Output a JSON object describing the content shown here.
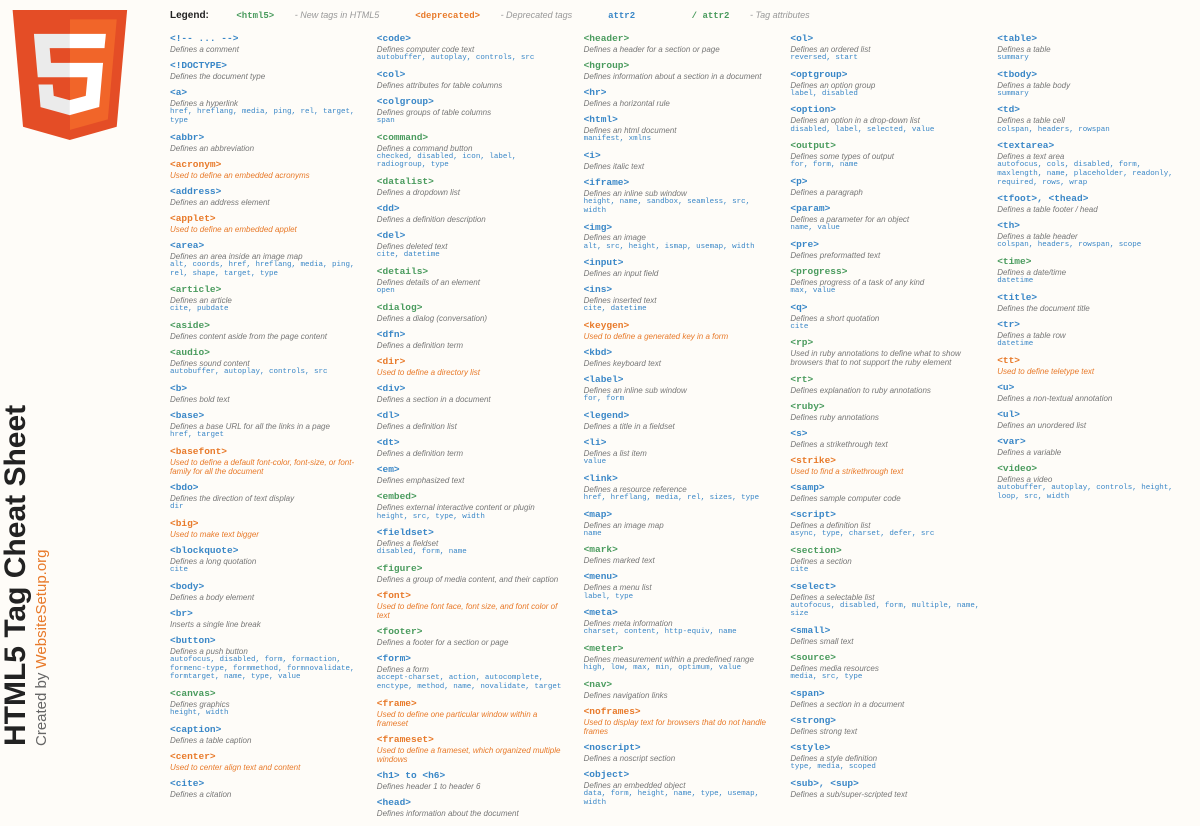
{
  "title": "HTML5 Tag Cheat Sheet",
  "subtitle_prefix": "Created by ",
  "subtitle_org": "WebsiteSetup.org",
  "legend_label": "Legend:",
  "legend_items": [
    {
      "tag": "<html5>",
      "cls": "green",
      "desc": "- New tags in HTML5"
    },
    {
      "tag": "<deprecated>",
      "cls": "warn",
      "desc": "- Deprecated tags"
    },
    {
      "tag": "attr2",
      "cls": "blue",
      "desc": ""
    },
    {
      "tag": "/  attr2",
      "cls": "green",
      "desc": "- Tag attributes"
    }
  ],
  "columns": [
    [
      {
        "tag": "<!-- ... -->",
        "cls": "normal",
        "desc": "Defines a comment"
      },
      {
        "tag": "<!DOCTYPE>",
        "cls": "normal",
        "desc": "Defines the document type"
      },
      {
        "tag": "<a>",
        "cls": "normal",
        "desc": "Defines a hyperlink",
        "attrs": "href, hreflang, media, ping, rel, target, type"
      },
      {
        "tag": "<abbr>",
        "cls": "normal",
        "desc": "Defines an abbreviation"
      },
      {
        "tag": "<acronym>",
        "cls": "dep",
        "desc": "Used to define an embedded acronyms",
        "depdesc": true
      },
      {
        "tag": "<address>",
        "cls": "normal",
        "desc": "Defines an address element"
      },
      {
        "tag": "<applet>",
        "cls": "dep",
        "desc": "Used to define an embedded applet",
        "depdesc": true
      },
      {
        "tag": "<area>",
        "cls": "normal",
        "desc": "Defines an area inside an image map",
        "attrs": "alt, coords, href, hreflang, media, ping, rel, shape, target, type"
      },
      {
        "tag": "<article>",
        "cls": "new",
        "desc": "Defines an article",
        "attrs": "cite, pubdate"
      },
      {
        "tag": "<aside>",
        "cls": "new",
        "desc": "Defines content aside from the page content"
      },
      {
        "tag": "<audio>",
        "cls": "new",
        "desc": "Defines sound content",
        "attrs": "autobuffer, autoplay, controls, src"
      },
      {
        "tag": "<b>",
        "cls": "normal",
        "desc": "Defines bold text"
      },
      {
        "tag": "<base>",
        "cls": "normal",
        "desc": "Defines a base URL for all the links in a page",
        "attrs": "href, target"
      },
      {
        "tag": "<basefont>",
        "cls": "dep",
        "desc": "Used to define a default font-color, font-size, or font-family for all the document",
        "depdesc": true
      },
      {
        "tag": "<bdo>",
        "cls": "normal",
        "desc": "Defines the direction of text display",
        "attrs": "dir"
      },
      {
        "tag": "<big>",
        "cls": "dep",
        "desc": "Used to make text bigger",
        "depdesc": true
      },
      {
        "tag": "<blockquote>",
        "cls": "normal",
        "desc": "Defines a long quotation",
        "attrs": "cite"
      },
      {
        "tag": "<body>",
        "cls": "normal",
        "desc": "Defines a body element"
      },
      {
        "tag": "<br>",
        "cls": "normal",
        "desc": "Inserts a single line break"
      },
      {
        "tag": "<button>",
        "cls": "normal",
        "desc": "Defines a push button",
        "attrs": "autofocus, disabled, form, formaction, formenc-type, formmethod, formnovalidate, formtarget, name, type, value"
      },
      {
        "tag": "<canvas>",
        "cls": "new",
        "desc": "Defines graphics",
        "attrs": "height, width"
      },
      {
        "tag": "<caption>",
        "cls": "normal",
        "desc": "Defines a table caption"
      },
      {
        "tag": "<center>",
        "cls": "dep",
        "desc": "Used to center align text and content",
        "depdesc": true
      },
      {
        "tag": "<cite>",
        "cls": "normal",
        "desc": "Defines a citation"
      }
    ],
    [
      {
        "tag": "<code>",
        "cls": "normal",
        "desc": "Defines computer code text",
        "attrs": "autobuffer, autoplay, controls, src"
      },
      {
        "tag": "<col>",
        "cls": "normal",
        "desc": "Defines attributes for table columns"
      },
      {
        "tag": "<colgroup>",
        "cls": "normal",
        "desc": "Defines groups of table columns",
        "attrs": "span"
      },
      {
        "tag": "<command>",
        "cls": "new",
        "desc": "Defines a command button",
        "attrs": "checked, disabled, icon, label, radiogroup, type"
      },
      {
        "tag": "<datalist>",
        "cls": "new",
        "desc": "Defines a dropdown list"
      },
      {
        "tag": "<dd>",
        "cls": "normal",
        "desc": "Defines a definition description"
      },
      {
        "tag": "<del>",
        "cls": "normal",
        "desc": "Defines deleted text",
        "attrs": "cite, datetime"
      },
      {
        "tag": "<details>",
        "cls": "new",
        "desc": "Defines details of an element",
        "attrs": "open"
      },
      {
        "tag": "<dialog>",
        "cls": "new",
        "desc": "Defines a dialog (conversation)"
      },
      {
        "tag": "<dfn>",
        "cls": "normal",
        "desc": "Defines a definition term"
      },
      {
        "tag": "<dir>",
        "cls": "dep",
        "desc": "Used to define a directory list",
        "depdesc": true
      },
      {
        "tag": "<div>",
        "cls": "normal",
        "desc": "Defines a section in a document"
      },
      {
        "tag": "<dl>",
        "cls": "normal",
        "desc": "Defines a definition list"
      },
      {
        "tag": "<dt>",
        "cls": "normal",
        "desc": "Defines a definition term"
      },
      {
        "tag": "<em>",
        "cls": "normal",
        "desc": "Defines emphasized text"
      },
      {
        "tag": "<embed>",
        "cls": "new",
        "desc": "Defines external interactive content or plugin",
        "attrs": "height, src, type, width"
      },
      {
        "tag": "<fieldset>",
        "cls": "normal",
        "desc": "Defines a fieldset",
        "attrs": "disabled, form, name"
      },
      {
        "tag": "<figure>",
        "cls": "new",
        "desc": "Defines a group of media content, and their caption"
      },
      {
        "tag": "<font>",
        "cls": "dep",
        "desc": "Used to define font face, font size, and font color of text",
        "depdesc": true
      },
      {
        "tag": "<footer>",
        "cls": "new",
        "desc": "Defines a footer for a section or page"
      },
      {
        "tag": "<form>",
        "cls": "normal",
        "desc": "Defines a form",
        "attrs": "accept-charset, action, autocomplete, enctype, method, name, novalidate, target"
      },
      {
        "tag": "<frame>",
        "cls": "dep",
        "desc": "Used to define one particular window within a frameset",
        "depdesc": true
      },
      {
        "tag": "<frameset>",
        "cls": "dep",
        "desc": "Used to define a frameset, which organized multiple windows",
        "depdesc": true
      },
      {
        "tag": "<h1> to <h6>",
        "cls": "normal",
        "desc": "Defines header 1 to header 6"
      },
      {
        "tag": "<head>",
        "cls": "normal",
        "desc": "Defines information about the document"
      }
    ],
    [
      {
        "tag": "<header>",
        "cls": "new",
        "desc": "Defines a header for a section or page"
      },
      {
        "tag": "<hgroup>",
        "cls": "new",
        "desc": "Defines information about a section in a document"
      },
      {
        "tag": "<hr>",
        "cls": "normal",
        "desc": "Defines a horizontal rule"
      },
      {
        "tag": "<html>",
        "cls": "normal",
        "desc": "Defines an html document",
        "attrs": "manifest, xmlns"
      },
      {
        "tag": "<i>",
        "cls": "normal",
        "desc": "Defines italic text"
      },
      {
        "tag": "<iframe>",
        "cls": "normal",
        "desc": "Defines an inline sub window",
        "attrs": "height, name, sandbox, seamless, src, width"
      },
      {
        "tag": "<img>",
        "cls": "normal",
        "desc": "Defines an image",
        "attrs": "alt, src, height, ismap, usemap, width"
      },
      {
        "tag": "<input>",
        "cls": "normal",
        "desc": "Defines an input field"
      },
      {
        "tag": "<ins>",
        "cls": "normal",
        "desc": "Defines inserted text",
        "attrs": "cite, datetime"
      },
      {
        "tag": "<keygen>",
        "cls": "dep",
        "desc": "Used to define a generated key in a form",
        "depdesc": true
      },
      {
        "tag": "<kbd>",
        "cls": "normal",
        "desc": "Defines keyboard text"
      },
      {
        "tag": "<label>",
        "cls": "normal",
        "desc": "Defines an inline sub window",
        "attrs": "for, form"
      },
      {
        "tag": "<legend>",
        "cls": "normal",
        "desc": "Defines a title in a fieldset"
      },
      {
        "tag": "<li>",
        "cls": "normal",
        "desc": "Defines a list item",
        "attrs": "value"
      },
      {
        "tag": "<link>",
        "cls": "normal",
        "desc": "Defines a resource reference",
        "attrs": "href, hreflang, media, rel, sizes, type"
      },
      {
        "tag": "<map>",
        "cls": "normal",
        "desc": "Defines an image map",
        "attrs": "name"
      },
      {
        "tag": "<mark>",
        "cls": "new",
        "desc": "Defines marked text"
      },
      {
        "tag": "<menu>",
        "cls": "normal",
        "desc": "Defines a menu list",
        "attrs": "label, type"
      },
      {
        "tag": "<meta>",
        "cls": "normal",
        "desc": "Defines meta information",
        "attrs": "charset, content, http-equiv, name"
      },
      {
        "tag": "<meter>",
        "cls": "new",
        "desc": "Defines measurement within a predefined range",
        "attrs": "high, low, max, min, optimum, value"
      },
      {
        "tag": "<nav>",
        "cls": "new",
        "desc": "Defines navigation links"
      },
      {
        "tag": "<noframes>",
        "cls": "dep",
        "desc": "Used to display text for browsers that do not handle frames",
        "depdesc": true
      },
      {
        "tag": "<noscript>",
        "cls": "normal",
        "desc": "Defines a noscript section"
      },
      {
        "tag": "<object>",
        "cls": "normal",
        "desc": "Defines an embedded object",
        "attrs": "data, form, height, name, type, usemap, width"
      }
    ],
    [
      {
        "tag": "<ol>",
        "cls": "normal",
        "desc": "Defines an ordered list",
        "attrs": "reversed, start"
      },
      {
        "tag": "<optgroup>",
        "cls": "normal",
        "desc": "Defines an option group",
        "attrs": "label, disabled"
      },
      {
        "tag": "<option>",
        "cls": "normal",
        "desc": "Defines an option in a drop-down list",
        "attrs": "disabled, label, selected, value"
      },
      {
        "tag": "<output>",
        "cls": "new",
        "desc": "Defines some types of output",
        "attrs": "for, form, name"
      },
      {
        "tag": "<p>",
        "cls": "normal",
        "desc": "Defines a paragraph"
      },
      {
        "tag": "<param>",
        "cls": "normal",
        "desc": "Defines a parameter for an object",
        "attrs": "name, value"
      },
      {
        "tag": "<pre>",
        "cls": "normal",
        "desc": "Defines preformatted text"
      },
      {
        "tag": "<progress>",
        "cls": "new",
        "desc": "Defines progress of a task of any kind",
        "attrs": "max, value"
      },
      {
        "tag": "<q>",
        "cls": "normal",
        "desc": "Defines a short quotation",
        "attrs": "cite"
      },
      {
        "tag": "<rp>",
        "cls": "new",
        "desc": "Used in ruby annotations to define what to show browsers that to not support the ruby element"
      },
      {
        "tag": "<rt>",
        "cls": "new",
        "desc": "Defines explanation to ruby annotations"
      },
      {
        "tag": "<ruby>",
        "cls": "new",
        "desc": "Defines ruby annotations"
      },
      {
        "tag": "<s>",
        "cls": "normal",
        "desc": "Defines a strikethrough text"
      },
      {
        "tag": "<strike>",
        "cls": "dep",
        "desc": "Used to find a strikethrough text",
        "depdesc": true
      },
      {
        "tag": "<samp>",
        "cls": "normal",
        "desc": "Defines sample computer code"
      },
      {
        "tag": "<script>",
        "cls": "normal",
        "desc": "Defines a definition list",
        "attrs": "async, type, charset, defer, src"
      },
      {
        "tag": "<section>",
        "cls": "new",
        "desc": "Defines a section",
        "attrs": "cite"
      },
      {
        "tag": "<select>",
        "cls": "normal",
        "desc": "Defines a selectable list",
        "attrs": "autofocus, disabled, form, multiple, name, size"
      },
      {
        "tag": "<small>",
        "cls": "normal",
        "desc": "Defines small text"
      },
      {
        "tag": "<source>",
        "cls": "new",
        "desc": "Defines media resources",
        "attrs": "media, src, type"
      },
      {
        "tag": "<span>",
        "cls": "normal",
        "desc": "Defines a section in a document"
      },
      {
        "tag": "<strong>",
        "cls": "normal",
        "desc": "Defines strong text"
      },
      {
        "tag": "<style>",
        "cls": "normal",
        "desc": "Defines a style definition",
        "attrs": "type, media, scoped"
      },
      {
        "tag": "<sub>, <sup>",
        "cls": "normal",
        "desc": "Defines a sub/super-scripted text"
      }
    ],
    [
      {
        "tag": "<table>",
        "cls": "normal",
        "desc": "Defines a table",
        "attrs": "summary"
      },
      {
        "tag": "<tbody>",
        "cls": "normal",
        "desc": "Defines a table body",
        "attrs": "summary"
      },
      {
        "tag": "<td>",
        "cls": "normal",
        "desc": "Defines a table cell",
        "attrs": "colspan, headers, rowspan"
      },
      {
        "tag": "<textarea>",
        "cls": "normal",
        "desc": "Defines a text area",
        "attrs": "autofocus, cols, disabled, form, maxlength, name, placeholder, readonly, required, rows, wrap"
      },
      {
        "tag": "<tfoot>, <thead>",
        "cls": "normal",
        "desc": "Defines a table footer / head"
      },
      {
        "tag": "<th>",
        "cls": "normal",
        "desc": "Defines a table header",
        "attrs": "colspan, headers, rowspan, scope"
      },
      {
        "tag": "<time>",
        "cls": "new",
        "desc": "Defines a date/time",
        "attrs": "datetime"
      },
      {
        "tag": "<title>",
        "cls": "normal",
        "desc": "Defines the document title"
      },
      {
        "tag": "<tr>",
        "cls": "normal",
        "desc": "Defines a table row",
        "attrs": "datetime"
      },
      {
        "tag": "<tt>",
        "cls": "dep",
        "desc": "Used to define teletype text",
        "depdesc": true
      },
      {
        "tag": "<u>",
        "cls": "normal",
        "desc": "Defines a non-textual annotation"
      },
      {
        "tag": "<ul>",
        "cls": "normal",
        "desc": "Defines an unordered list"
      },
      {
        "tag": "<var>",
        "cls": "normal",
        "desc": "Defines a variable"
      },
      {
        "tag": "<video>",
        "cls": "new",
        "desc": "Defines a video",
        "attrs": "autobuffer, autoplay, controls, height, loop, src, width"
      }
    ]
  ]
}
